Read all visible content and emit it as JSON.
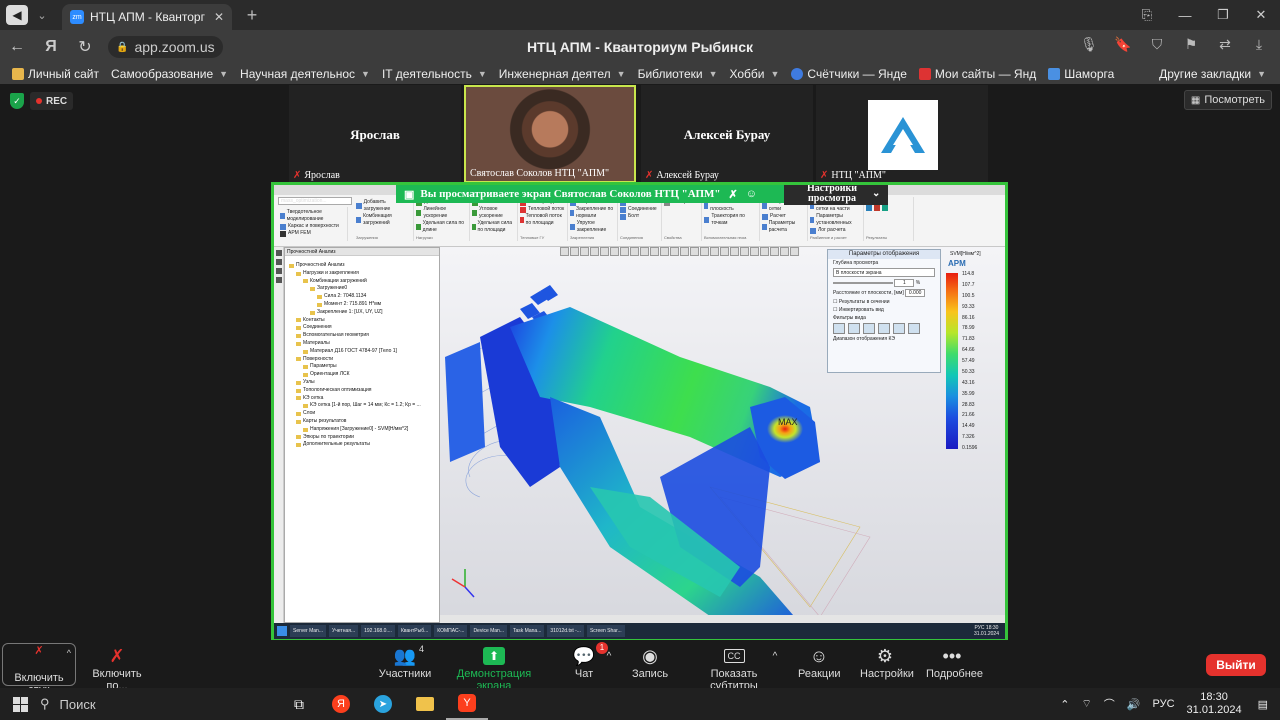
{
  "browser": {
    "tab_title": "НТЦ АПМ - Кванторг",
    "tab_favicon": "zm",
    "url": "app.zoom.us",
    "page_title": "НТЦ АПМ - Кванториум Рыбинск"
  },
  "bookmarks": [
    {
      "label": "Личный сайт"
    },
    {
      "label": "Самообразование",
      "dropdown": true
    },
    {
      "label": "Научная деятельнос",
      "dropdown": true
    },
    {
      "label": "IT деятельность",
      "dropdown": true
    },
    {
      "label": "Инженерная деятел",
      "dropdown": true
    },
    {
      "label": "Библиотеки",
      "dropdown": true
    },
    {
      "label": "Хобби",
      "dropdown": true
    },
    {
      "label": "Счётчики — Янде"
    },
    {
      "label": "Мои сайты — Янд"
    },
    {
      "label": "Шаморга"
    }
  ],
  "bookmarks_other": "Другие закладки",
  "zoom": {
    "rec_label": "REC",
    "view_button": "Посмотреть",
    "participants": [
      {
        "big_name": "Ярослав",
        "label": "Ярослав",
        "muted": true
      },
      {
        "big_name": "",
        "label": "Святослав Соколов НТЦ \"АПМ\"",
        "muted": false,
        "video": true
      },
      {
        "big_name": "Алексей Бурау",
        "label": "Алексей Бурау",
        "muted": true
      },
      {
        "big_name": "",
        "label": "НТЦ \"АПМ\"",
        "muted": true,
        "logo": true
      }
    ],
    "share_banner": "Вы просматриваете экран  Святослав Соколов НТЦ \"АПМ\"",
    "view_options": "Настройки просмотра"
  },
  "shared_app": {
    "title": "",
    "doc_tab": "mass_optimization...",
    "ribbon_groups": [
      {
        "items": [
          "Твердотельное моделирование",
          "Каркас и поверхности",
          "APM FEM"
        ],
        "label": ""
      },
      {
        "items": [
          "Добавить загружение",
          "Комбинация загружений",
          "Сплошные"
        ],
        "label": "Загружения"
      },
      {
        "items": [
          "Давление",
          "Линейное ускорение",
          "Удельная сила по длине"
        ],
        "label": "Нагрузки"
      },
      {
        "items": [
          "Сила",
          "Угловое ускорение",
          "Удельная сила по площади"
        ],
        "label": ""
      },
      {
        "items": [
          "Температура",
          "Тепловой поток",
          "Тепловой поток по площади"
        ],
        "label": "Тепловые ГУ"
      },
      {
        "items": [
          "Закрепление",
          "Закрепление по нормали",
          "Упругое закрепление"
        ],
        "label": "Закрепления"
      },
      {
        "items": [
          "Контакт",
          "Соединение",
          "Болт"
        ],
        "label": "Соединения"
      },
      {
        "items": [
          "Материал"
        ],
        "label": "Свойства"
      },
      {
        "items": [
          "Вспомогательная плоскость",
          "Траектория по точкам"
        ],
        "label": "Вспомогательная геом."
      },
      {
        "items": [
          "Генерация КЭ сетки",
          "Расчет",
          "Параметры расчета"
        ],
        "label": ""
      },
      {
        "items": [
          "Генерация КЭ сетки на части",
          "Параметры установленных",
          "Лог расчета"
        ],
        "label": "Разбиение и расчет"
      },
      {
        "items": [
          "Результаты"
        ],
        "label": "Результаты"
      }
    ],
    "tree_header": "Прочностной Анализ",
    "tree": [
      "Прочностной Анализ",
      "Нагрузки и закрепления",
      "Комбинации загружений",
      "Загружение0",
      "Сила 2: 7048.1134",
      "Момент 2: 715.891 Н*мм",
      "Закрепление 1: [UX, UY, UZ]",
      "Контакты",
      "Соединения",
      "Вспомогательная геометрия",
      "Материалы",
      "Материал Д16 ГОСТ 4784-97 [Тело 1]",
      "Поверхности",
      "Параметры",
      "Ориентация ЛСК",
      "Узлы",
      "Топологическая оптимизация",
      "КЭ сетка",
      "КЭ сетка [1-й пор, Шаг = 14 мм; Кс = 1.2; Кр = ...",
      "Слои",
      "Карты результатов",
      "Напряжения [Загружение0] - SVM[Н/мм^2]",
      "Эпюры по траектории",
      "Дополнительные результаты"
    ],
    "param_panel": {
      "title": "Параметры отображения",
      "depth_label": "Глубина просмотра",
      "depth_mode": "В плоскости экрана",
      "depth_value": "1",
      "depth_unit": "%",
      "distance_label": "Расстояние от плоскости, [мм]",
      "distance_value": "0.000",
      "check_section": "Результаты в сечении",
      "check_invert": "Инвертировать вид",
      "filters_label": "Фильтры вида",
      "range_label": "Диапазон отображения КЭ"
    },
    "legend": {
      "title": "SVM[Н/мм^2]",
      "logo": "APM",
      "values": [
        "114.8",
        "107.7",
        "100.5",
        "93.33",
        "86.16",
        "78.99",
        "71.83",
        "64.66",
        "57.49",
        "50.33",
        "43.16",
        "35.99",
        "28.83",
        "21.66",
        "14.49",
        "7.326",
        "0.1596"
      ]
    },
    "max_label": "MAX",
    "inner_taskbar": [
      "Server Man...",
      "Учетная...",
      "192.168.0....",
      "КвантРыб...",
      "КОМПАС-...",
      "Device Man...",
      "Task Mana...",
      "31012d.txt -...",
      "Screen Shar..."
    ],
    "inner_tray": {
      "lang": "РУС",
      "time": "18:30",
      "date": "31.01.2024"
    }
  },
  "toolbar": {
    "mic": "Включить звук",
    "video": "Включить по...",
    "participants": "Участники",
    "participants_count": "4",
    "share": "Демонстрация экрана",
    "chat": "Чат",
    "chat_badge": "1",
    "record": "Запись",
    "captions": "Показать субтитры",
    "reactions": "Реакции",
    "settings": "Настройки",
    "more": "Подробнее",
    "end": "Выйти"
  },
  "taskbar": {
    "search": "Поиск",
    "lang": "РУС",
    "time": "18:30",
    "date": "31.01.2024"
  },
  "colors": {
    "share_border": "#35c43b",
    "end_button": "#e5322d",
    "share_text": "#1db954"
  }
}
